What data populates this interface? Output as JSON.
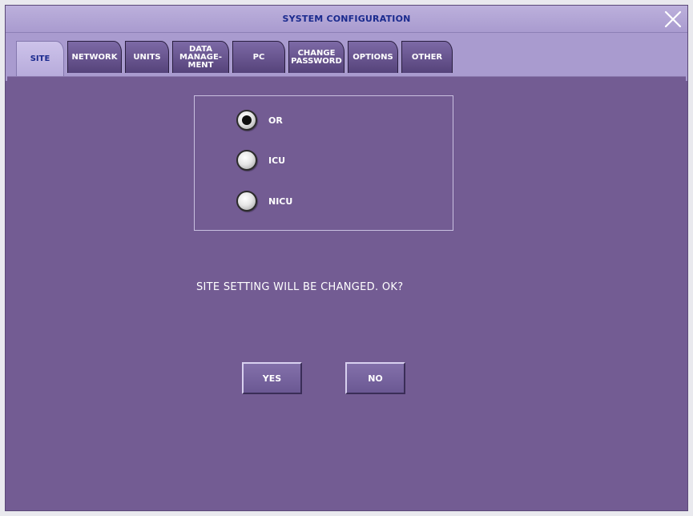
{
  "window": {
    "title": "SYSTEM CONFIGURATION",
    "close_icon": "close-x-icon"
  },
  "tabs": [
    {
      "label": "SITE",
      "active": true
    },
    {
      "label": "NETWORK",
      "active": false
    },
    {
      "label": "UNITS",
      "active": false
    },
    {
      "label": "DATA\nMANAGE-\nMENT",
      "active": false
    },
    {
      "label": "PC",
      "active": false
    },
    {
      "label": "CHANGE\nPASSWORD",
      "active": false
    },
    {
      "label": "OPTIONS",
      "active": false
    },
    {
      "label": "OTHER",
      "active": false
    }
  ],
  "site_options": [
    {
      "label": "OR",
      "selected": true
    },
    {
      "label": "ICU",
      "selected": false
    },
    {
      "label": "NICU",
      "selected": false
    }
  ],
  "confirm": {
    "message": "SITE SETTING WILL BE CHANGED. OK?",
    "yes_label": "YES",
    "no_label": "NO"
  },
  "colors": {
    "panel": "#735c93",
    "title_text": "#1a2a8e",
    "header": "#a99bcf"
  }
}
